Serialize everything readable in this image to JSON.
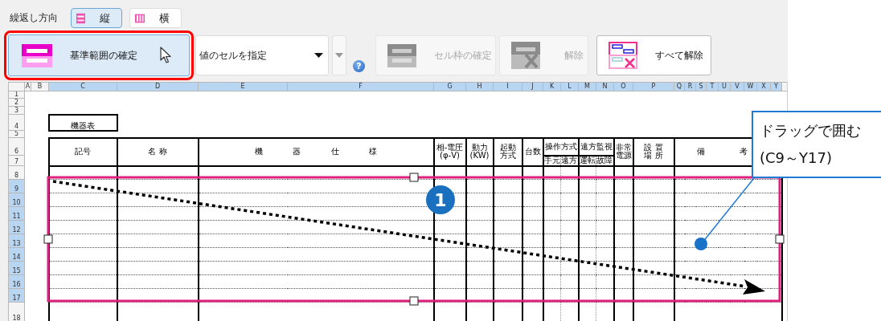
{
  "toolbar": {
    "direction_label": "繰返し方向",
    "directions": [
      {
        "label": "縦",
        "kind": "rows",
        "selected": true
      },
      {
        "label": "横",
        "kind": "columns",
        "selected": false
      }
    ],
    "base_button": {
      "label": "基準範囲の確定",
      "highlighted": true
    },
    "value_dropdown": {
      "value": "値のセルを指定"
    },
    "help": "?",
    "actions": [
      {
        "label": "セル枠の確定",
        "kind": "frame",
        "disabled": true
      },
      {
        "label": "解除",
        "kind": "clear",
        "disabled": true
      },
      {
        "label": "すべて解除",
        "kind": "clear_all",
        "disabled": false
      }
    ]
  },
  "sheet": {
    "columns": [
      {
        "label": "A",
        "selected": false
      },
      {
        "label": "B",
        "selected": false
      },
      {
        "label": "C",
        "selected": true
      },
      {
        "label": "D",
        "selected": true
      },
      {
        "label": "E",
        "selected": true
      },
      {
        "label": "F",
        "selected": true
      },
      {
        "label": "G",
        "selected": true
      },
      {
        "label": "H",
        "selected": true
      },
      {
        "label": "I",
        "selected": true
      },
      {
        "label": "J",
        "selected": true
      },
      {
        "label": "K",
        "selected": true
      },
      {
        "label": "L",
        "selected": true
      },
      {
        "label": "M",
        "selected": true
      },
      {
        "label": "N",
        "selected": true
      },
      {
        "label": "O",
        "selected": true
      },
      {
        "label": "P",
        "selected": true
      },
      {
        "label": "Q",
        "selected": true
      },
      {
        "label": "R",
        "selected": true
      },
      {
        "label": "S",
        "selected": true
      },
      {
        "label": "T",
        "selected": true
      },
      {
        "label": "U",
        "selected": true
      },
      {
        "label": "V",
        "selected": true
      },
      {
        "label": "W",
        "selected": true
      },
      {
        "label": "X",
        "selected": true
      },
      {
        "label": "Y",
        "selected": true
      }
    ],
    "rows": [
      {
        "label": "1",
        "selected": false
      },
      {
        "label": "2",
        "selected": false
      },
      {
        "label": "3",
        "selected": false
      },
      {
        "label": "4",
        "selected": false
      },
      {
        "label": "5",
        "selected": false
      },
      {
        "label": "6",
        "selected": false
      },
      {
        "label": "7",
        "selected": false
      },
      {
        "label": "8",
        "selected": false
      },
      {
        "label": "9",
        "selected": true
      },
      {
        "label": "10",
        "selected": true
      },
      {
        "label": "11",
        "selected": true
      },
      {
        "label": "12",
        "selected": true
      },
      {
        "label": "13",
        "selected": true
      },
      {
        "label": "14",
        "selected": true
      },
      {
        "label": "15",
        "selected": true
      },
      {
        "label": "16",
        "selected": true
      },
      {
        "label": "17",
        "selected": true
      },
      {
        "label": "18",
        "selected": false
      }
    ],
    "title": "機器表",
    "header_cells": [
      {
        "lines": [
          "記号"
        ]
      },
      {
        "lines": [
          "名 称"
        ]
      },
      {
        "lines": [
          "機 器 仕 様"
        ]
      },
      {
        "lines": [
          "相-電圧",
          "(φ-V)"
        ]
      },
      {
        "lines": [
          "動力",
          "(KW)"
        ]
      },
      {
        "lines": [
          "起動",
          "方式"
        ]
      },
      {
        "lines": [
          "台数"
        ]
      },
      {
        "lines": [
          "操作方式"
        ]
      },
      {
        "lines": [
          "遠方監視"
        ]
      },
      {
        "lines": [
          "非常",
          "電源"
        ]
      },
      {
        "lines": [
          "設 置",
          "場 所"
        ]
      },
      {
        "lines": [
          "備 考"
        ]
      }
    ],
    "sub_header_cells": [
      "手元",
      "遠方",
      "運転",
      "故障"
    ]
  },
  "step_badge": "1",
  "callout": {
    "lines": [
      "ドラッグで囲む",
      "(C9～Y17)"
    ]
  }
}
